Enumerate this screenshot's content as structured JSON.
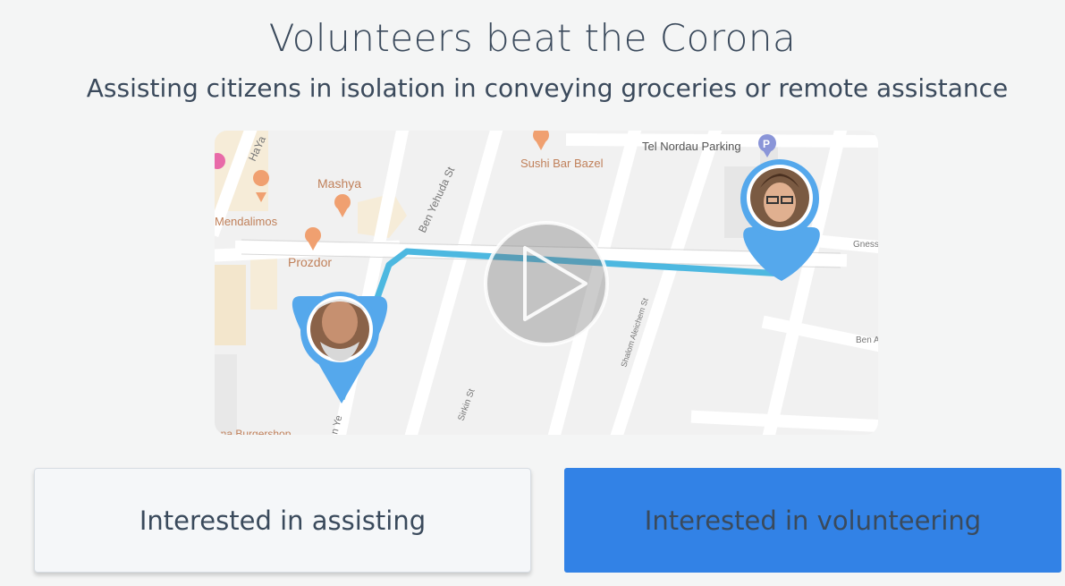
{
  "header": {
    "title": "Volunteers beat the Corona",
    "subtitle": "Assisting citizens in isolation in conveying groceries or remote assistance"
  },
  "map": {
    "labels": {
      "hayarkon": "HaYa",
      "mashya": "Mashya",
      "mendalimos": "Mendalimos",
      "prozdor": "Prozdor",
      "ben_yehuda": "Ben Yehuda St",
      "sushi_bar": "Sushi Bar Bazel",
      "tel_nordau": "Tel Nordau Parking",
      "gnessin": "Gness",
      "ben_ami": "Ben A",
      "sirkin": "Sirkin St",
      "sholem_aleichem": "Shalom Aleichem St",
      "ben_yehuda_short": "n Ye",
      "burgershop": "ana Burgershop"
    },
    "parking_icon": "P",
    "colors": {
      "route": "#4db8e0",
      "pin": "#55a8ec",
      "food_icon": "#f0a070"
    }
  },
  "actions": {
    "assist_label": "Interested in assisting",
    "volunteer_label": "Interested in volunteering",
    "volunteer_color": "#3282e6"
  }
}
